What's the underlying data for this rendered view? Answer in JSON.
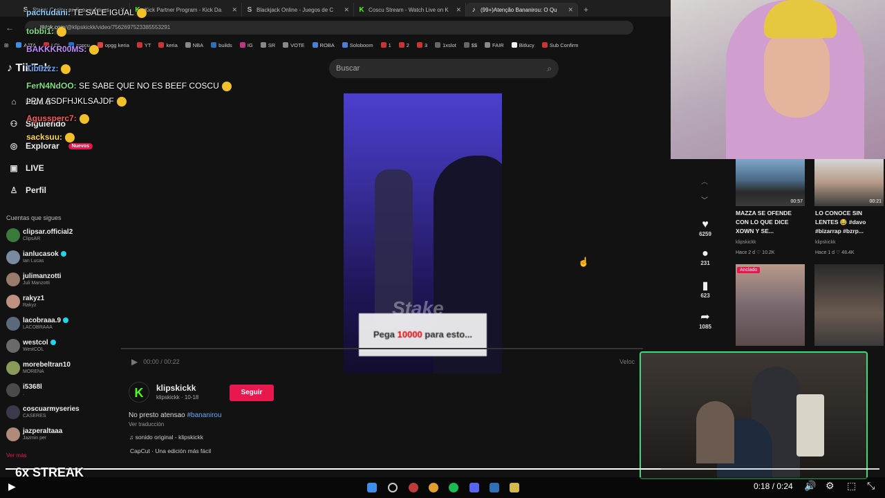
{
  "browser": {
    "tabs": [
      {
        "icon": "S",
        "title": "Stake: Casino en línea y Apues"
      },
      {
        "icon": "K",
        "title": "Kick Partner Program - Kick Da"
      },
      {
        "icon": "S",
        "title": "Blackjack Online - Juegos de C"
      },
      {
        "icon": "K",
        "title": "Coscu Stream - Watch Live on K"
      },
      {
        "icon": "♪",
        "title": "(99+)Atenção Bananirou: O Qu"
      }
    ],
    "new_tab": "+",
    "url_host": "tiktok.com",
    "url_path": "/@klipskickk/video/7562697523385553291",
    "bookmarks": [
      "AJTA",
      "LOL",
      "coscu",
      "opgg keria",
      "YT",
      "keria",
      "NBA",
      "builds",
      "IG",
      "SR",
      "VOTE",
      "ROBA",
      "Soloboom",
      "1",
      "2",
      "3",
      "1xslot",
      "$$",
      "FAIR",
      "Bitlucy",
      "Sub Confirm"
    ]
  },
  "tiktok": {
    "logo": "TikTok",
    "search_placeholder": "Buscar",
    "nav": [
      {
        "label": "Para ti",
        "icon": "home-icon"
      },
      {
        "label": "Siguiendo",
        "icon": "people-icon"
      },
      {
        "label": "Explorar",
        "icon": "compass-icon",
        "badge": "Nuevos"
      },
      {
        "label": "LIVE",
        "icon": "live-icon"
      },
      {
        "label": "Perfil",
        "icon": "person-icon"
      }
    ],
    "following_heading": "Cuentas que sigues",
    "accounts": [
      {
        "name": "clipsar.official2",
        "sub": "ClipsAR",
        "verified": false
      },
      {
        "name": "ianlucasok",
        "sub": "Ian Lucas",
        "verified": true
      },
      {
        "name": "julimanzotti",
        "sub": "Juli Manzotti",
        "verified": false
      },
      {
        "name": "rakyz1",
        "sub": "Rakyz",
        "verified": false
      },
      {
        "name": "lacobraaa.9",
        "sub": "LACOBRAAA",
        "verified": true
      },
      {
        "name": "westcol",
        "sub": "WestCOL",
        "verified": true
      },
      {
        "name": "morebeltran10",
        "sub": "MORENA",
        "verified": false
      },
      {
        "name": "i5368l",
        "sub": ".",
        "verified": false
      },
      {
        "name": "coscuarmyseries",
        "sub": "CASERES",
        "verified": false
      },
      {
        "name": "jazperaltaaa",
        "sub": "Jazmin per",
        "verified": false
      }
    ],
    "see_more": "Ver más",
    "video": {
      "caption_pre": "Pega ",
      "caption_red": "10000",
      "caption_post": " para esto...",
      "watermark": "Stake",
      "time": "00:00 / 00:22",
      "speed": "Veloc"
    },
    "actions": [
      {
        "icon": "heart-icon",
        "count": "6259"
      },
      {
        "icon": "comment-icon",
        "count": "231"
      },
      {
        "icon": "bookmark-icon",
        "count": "623"
      },
      {
        "icon": "share-icon",
        "count": "1085"
      }
    ],
    "author": {
      "logo": "K",
      "name": "klipskickk",
      "meta": "klipskickk · 10-18",
      "follow": "Seguir",
      "desc": "No presto atensao ",
      "hashtag": "#bananirou",
      "translate": "Ver traducción",
      "sound": "♫  sonido original - klipskickk",
      "capcut": "CapCut · Una edición más fácil"
    },
    "related": [
      {
        "title": "MAZZA SE OFENDE CON LO QUE DICE XOWN Y SE...",
        "user": "klipskickk",
        "stats": "Hace 2 d  ♡ 10.2K",
        "duration": "00:57"
      },
      {
        "title": "LO CONOCE SIN LENTES 😂 #davo #bizarrap #bzrp...",
        "user": "klipskickk",
        "stats": "Hace 1 d  ♡ 48.4K",
        "duration": "00:21"
      }
    ],
    "pinned_badge": "Anclado"
  },
  "chat": [
    {
      "user": "pachudani:",
      "msg": " TE SALE IGUAL",
      "color": "#8fd0ff"
    },
    {
      "user": "tobbi1:",
      "msg": "",
      "color": "#7fe07f"
    },
    {
      "user": "BAKKKR00MS:",
      "msg": "",
      "color": "#c08cff"
    },
    {
      "user": "Tiblizzz:",
      "msg": "",
      "color": "#6aa8ff"
    },
    {
      "user": "FerN4NdOO:",
      "msg": " SE SABE QUE NO ES BEEF COSCU",
      "color": "#7fe07f"
    },
    {
      "user": "",
      "msg": "LPM ASDFHJKLSAJDF",
      "color": "#ffffff"
    },
    {
      "user": "Agussperc7:",
      "msg": "",
      "color": "#ff5a5a"
    },
    {
      "user": "sacksuu:",
      "msg": "",
      "color": "#ffd84a"
    }
  ],
  "overlay": {
    "streak": "6x STREAK",
    "timer": "0:18 / 0:24",
    "progress_fraction": 0.75
  },
  "colors": {
    "accent": "#e8174d",
    "kick_green": "#53fc18"
  }
}
